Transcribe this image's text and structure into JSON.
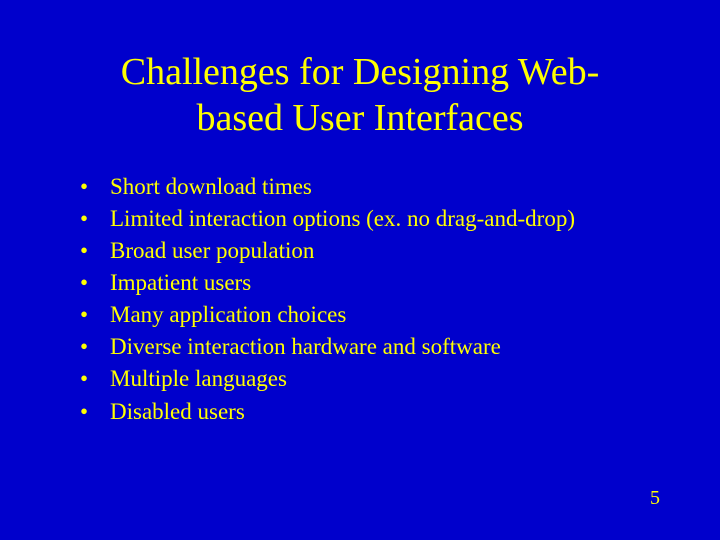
{
  "title_line1": "Challenges for Designing Web-",
  "title_line2": "based User Interfaces",
  "bullets": {
    "0": "Short download times",
    "1": "Limited interaction options (ex. no drag-and-drop)",
    "2": "Broad user population",
    "3": "Impatient users",
    "4": "Many application choices",
    "5": "Diverse interaction hardware and software",
    "6": "Multiple languages",
    "7": "Disabled users"
  },
  "page_number": "5"
}
